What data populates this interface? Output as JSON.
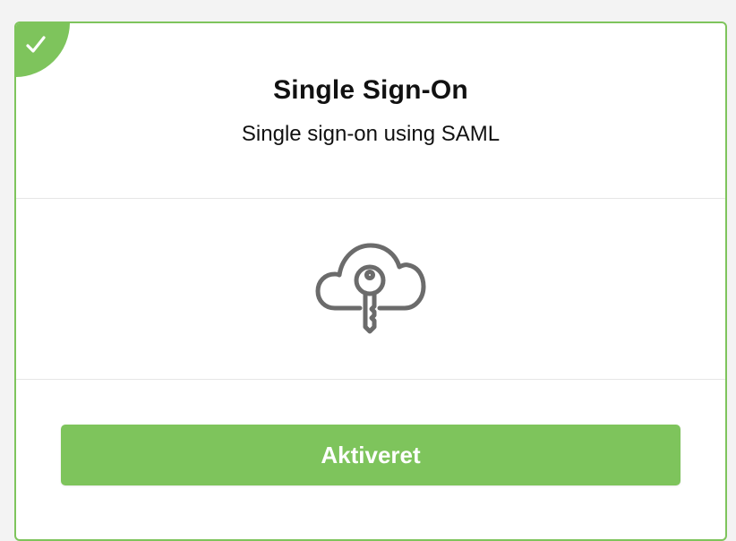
{
  "card": {
    "title": "Single Sign-On",
    "subtitle": "Single sign-on using SAML",
    "status_icon": "checkmark-icon",
    "feature_icon": "cloud-key-icon",
    "button_label": "Aktiveret"
  },
  "colors": {
    "accent": "#7ec45c",
    "icon": "#6b6b6b",
    "background": "#f3f3f3"
  }
}
